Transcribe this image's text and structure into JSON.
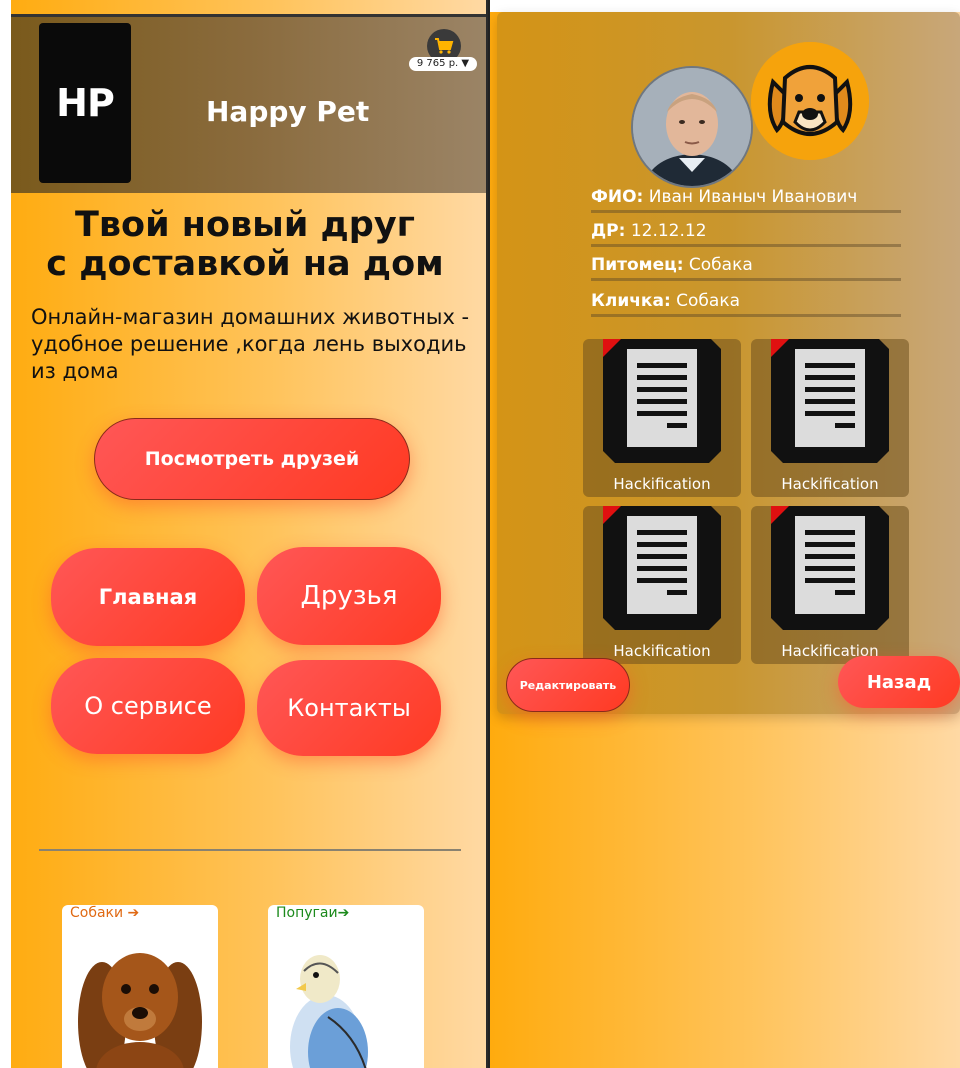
{
  "left": {
    "brand": {
      "logo": "HP",
      "name": "Happy Pet"
    },
    "cart": {
      "total": "9 765 р. ▼"
    },
    "hero": {
      "title_line1": "Твой новый друг",
      "title_line2": "с доставкой на дом",
      "subtitle": "Онлайн-магазин домашних животных - удобное решение ,когда лень выходиь из дома"
    },
    "cta": "Посмотреть друзей",
    "nav": {
      "main": "Главная",
      "friends": "Друзья",
      "about": "О сервисе",
      "contacts": "Контакты"
    },
    "categories": [
      {
        "label": "Собаки ➔",
        "image": "dachshund-photo"
      },
      {
        "label": "Попугаи➔",
        "image": "budgie-photo"
      }
    ]
  },
  "right": {
    "avatars": {
      "user": "user-portrait",
      "pet": "dog-cartoon"
    },
    "fields": [
      {
        "label": "ФИО:",
        "value": "Иван Иваныч Иванович"
      },
      {
        "label": "ДР:",
        "value": "12.12.12"
      },
      {
        "label": "Питомец:",
        "value": "Собака"
      },
      {
        "label": "Кличка:",
        "value": "Собака"
      }
    ],
    "documents": [
      {
        "title": "Hackification"
      },
      {
        "title": "Hackification"
      },
      {
        "title": "Hackification"
      },
      {
        "title": "Hackification"
      }
    ],
    "buttons": {
      "edit": "Редактировать",
      "back": "Назад"
    }
  },
  "colors": {
    "accent_red": "#ff4a3a",
    "bg_orange": "#ffab0e",
    "header_brown": "#7a5a1c"
  }
}
